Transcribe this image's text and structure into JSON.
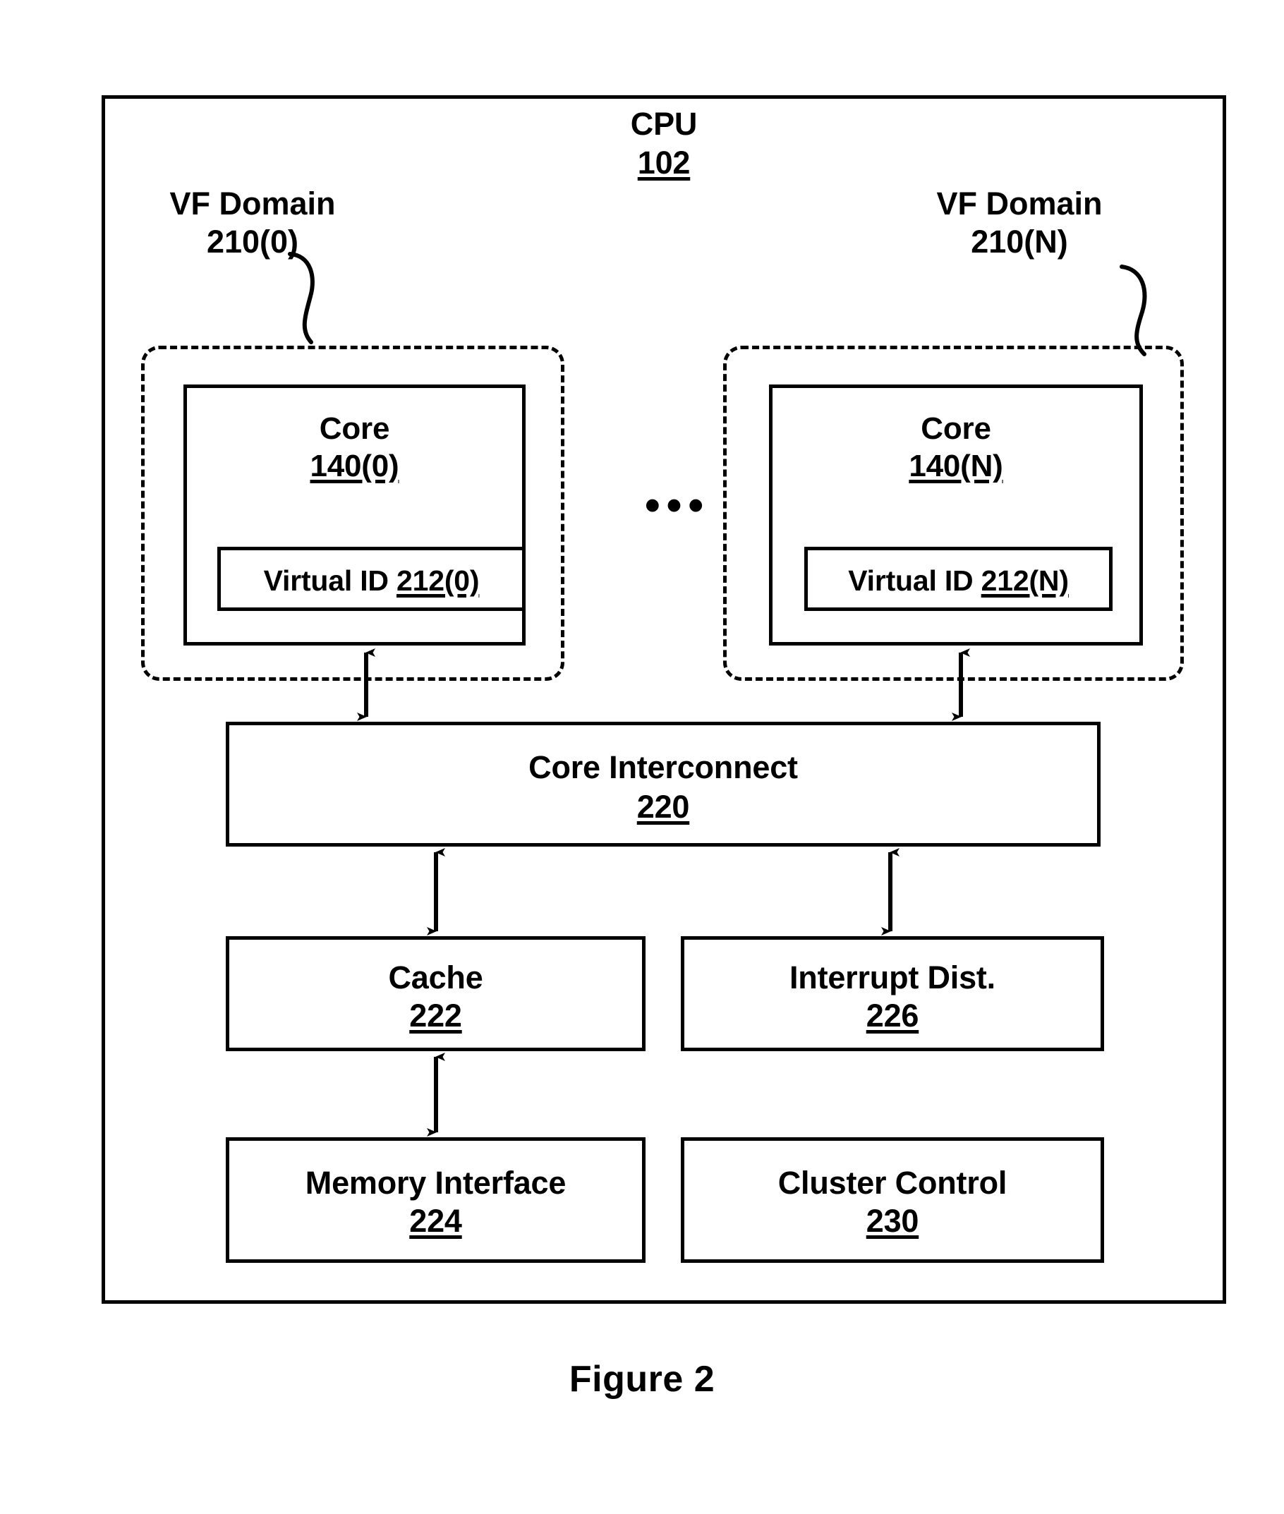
{
  "figure": {
    "caption": "Figure 2"
  },
  "cpu": {
    "title": "CPU",
    "ref": "102"
  },
  "vf_domains": [
    {
      "label_line1": "VF Domain",
      "label_line2": "210(0)",
      "core": {
        "title": "Core",
        "ref": "140(0)",
        "virtual_id_label": "Virtual ID ",
        "virtual_id_ref": "212(0)"
      }
    },
    {
      "label_line1": "VF Domain",
      "label_line2": "210(N)",
      "core": {
        "title": "Core",
        "ref": "140(N)",
        "virtual_id_label": "Virtual ID ",
        "virtual_id_ref": "212(N)"
      }
    }
  ],
  "ellipsis": "•••",
  "blocks": {
    "interconnect": {
      "title": "Core Interconnect",
      "ref": "220"
    },
    "cache": {
      "title": "Cache",
      "ref": "222"
    },
    "interrupt_dist": {
      "title": "Interrupt Dist.",
      "ref": "226"
    },
    "memory_interface": {
      "title": "Memory Interface",
      "ref": "224"
    },
    "cluster_control": {
      "title": "Cluster Control",
      "ref": "230"
    }
  },
  "colors": {
    "line": "#000000",
    "background": "#ffffff"
  }
}
